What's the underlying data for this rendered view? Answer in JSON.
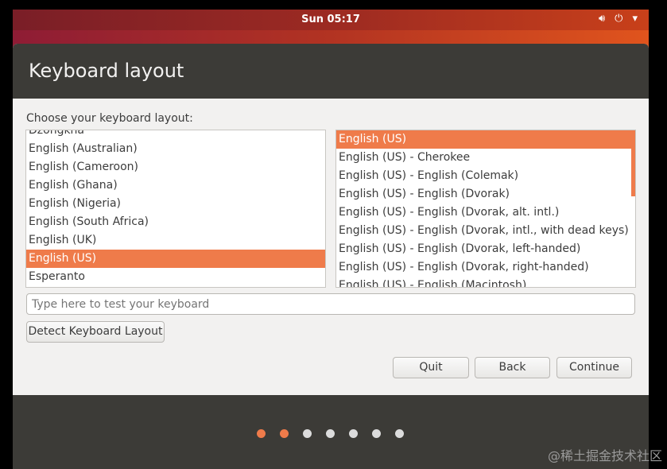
{
  "topbar": {
    "clock": "Sun 05:17",
    "icons": [
      "volume-icon",
      "power-icon",
      "chevron-down-icon"
    ]
  },
  "header": {
    "title": "Keyboard layout"
  },
  "prompt": "Choose your keyboard layout:",
  "layouts": [
    "Dzongkha",
    "English (Australian)",
    "English (Cameroon)",
    "English (Ghana)",
    "English (Nigeria)",
    "English (South Africa)",
    "English (UK)",
    "English (US)",
    "Esperanto"
  ],
  "layouts_selected": "English (US)",
  "variants": [
    "English (US)",
    "English (US) - Cherokee",
    "English (US) - English (Colemak)",
    "English (US) - English (Dvorak)",
    "English (US) - English (Dvorak, alt. intl.)",
    "English (US) - English (Dvorak, intl., with dead keys)",
    "English (US) - English (Dvorak, left-handed)",
    "English (US) - English (Dvorak, right-handed)",
    "English (US) - English (Macintosh)"
  ],
  "variants_selected": "English (US)",
  "test_placeholder": "Type here to test your keyboard",
  "buttons": {
    "detect": "Detect Keyboard Layout",
    "quit": "Quit",
    "back": "Back",
    "continue": "Continue"
  },
  "progress": {
    "total_steps": 7,
    "current_step": 2
  },
  "colors": {
    "accent": "#ef7b4a",
    "header": "#3c3b37"
  },
  "watermark": "@稀土掘金技术社区"
}
